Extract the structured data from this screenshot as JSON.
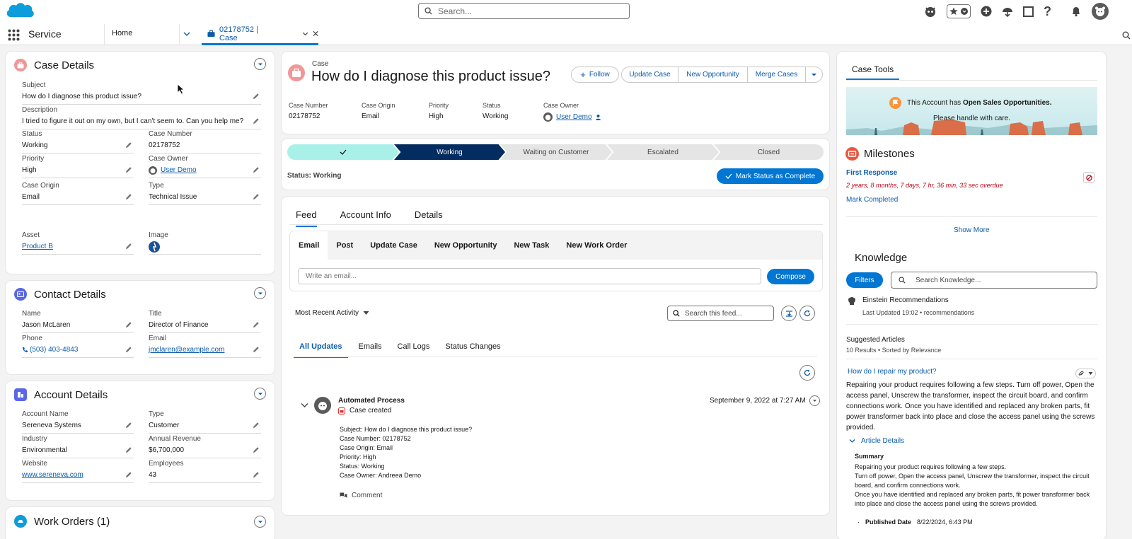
{
  "topbar": {
    "search_placeholder": "Search..."
  },
  "nav": {
    "app_name": "Service",
    "tabs": [
      {
        "label": "Home"
      },
      {
        "label": "02178752 | Case"
      }
    ]
  },
  "case_details": {
    "title": "Case Details",
    "fields": [
      {
        "label": "Subject",
        "value": "How do I diagnose this product issue?"
      },
      {
        "label": "Description",
        "value": "I tried to figure it out on my own, but I can't seem to. Can you help me?"
      },
      {
        "label": "Status",
        "value": "Working"
      },
      {
        "label": "Case Number",
        "value": "02178752"
      },
      {
        "label": "Priority",
        "value": "High"
      },
      {
        "label": "Case Owner",
        "value": "User Demo"
      },
      {
        "label": "Case Origin",
        "value": "Email"
      },
      {
        "label": "Type",
        "value": "Technical Issue"
      },
      {
        "label": "Asset",
        "value": "Product B"
      },
      {
        "label": "Image",
        "value": ""
      }
    ]
  },
  "contact_details": {
    "title": "Contact Details",
    "fields": [
      {
        "label": "Name",
        "value": "Jason McLaren"
      },
      {
        "label": "Title",
        "value": "Director of Finance"
      },
      {
        "label": "Phone",
        "value": "(503) 403-4843"
      },
      {
        "label": "Email",
        "value": "jmclaren@example.com"
      }
    ]
  },
  "account_details": {
    "title": "Account Details",
    "fields": [
      {
        "label": "Account Name",
        "value": "Sereneva Systems"
      },
      {
        "label": "Type",
        "value": "Customer"
      },
      {
        "label": "Industry",
        "value": "Environmental"
      },
      {
        "label": "Annual Revenue",
        "value": "$6,700,000"
      },
      {
        "label": "Website",
        "value": "www.sereneva.com"
      },
      {
        "label": "Employees",
        "value": "43"
      }
    ]
  },
  "work_orders": {
    "title": "Work Orders (1)"
  },
  "case_header": {
    "object_label": "Case",
    "title": "How do I diagnose this product issue?",
    "actions": {
      "follow": "Follow",
      "update": "Update Case",
      "new_opp": "New Opportunity",
      "merge": "Merge Cases"
    },
    "highlights": [
      {
        "label": "Case Number",
        "value": "02178752"
      },
      {
        "label": "Case Origin",
        "value": "Email"
      },
      {
        "label": "Priority",
        "value": "High"
      },
      {
        "label": "Status",
        "value": "Working"
      },
      {
        "label": "Case Owner",
        "value": "User Demo"
      }
    ]
  },
  "path": {
    "steps": [
      "",
      "Working",
      "Waiting on Customer",
      "Escalated",
      "Closed"
    ],
    "status_text": "Status: Working",
    "complete_button": "Mark Status as Complete"
  },
  "main_tabs": [
    "Feed",
    "Account Info",
    "Details"
  ],
  "publisher": {
    "tabs": [
      "Email",
      "Post",
      "Update Case",
      "New Opportunity",
      "New Task",
      "New Work Order"
    ],
    "placeholder": "Write an email...",
    "compose": "Compose"
  },
  "feed": {
    "sort": "Most Recent Activity",
    "search_placeholder": "Search this feed...",
    "filters": [
      "All Updates",
      "Emails",
      "Call Logs",
      "Status Changes"
    ],
    "item": {
      "author": "Automated Process",
      "action": "Case created",
      "timestamp": "September 9, 2022 at 7:27 AM",
      "lines": [
        {
          "k": "Subject:",
          "v": "How do I diagnose this product issue?"
        },
        {
          "k": "Case Number:",
          "v": "02178752"
        },
        {
          "k": "Case Origin:",
          "v": "Email"
        },
        {
          "k": "Priority:",
          "v": "High"
        },
        {
          "k": "Status:",
          "v": "Working"
        },
        {
          "k": "Case Owner:",
          "v": "Andreea Demo"
        }
      ],
      "comment": "Comment"
    }
  },
  "case_tools": {
    "tab": "Case Tools",
    "banner_prefix": "This Account has ",
    "banner_bold": "Open Sales Opportunities.",
    "banner_line2": "Please handle with care."
  },
  "milestones": {
    "title": "Milestones",
    "name": "First Response",
    "overdue": "2 years, 8 months, 7 days, 7 hr, 36 min, 33 sec overdue",
    "mark": "Mark Completed",
    "show_more": "Show More"
  },
  "knowledge": {
    "title": "Knowledge",
    "filters": "Filters",
    "search_placeholder": "Search Knowledge...",
    "einstein": "Einstein Recommendations",
    "updated": "Last Updated 19:02 • recommendations",
    "suggested": "Suggested Articles",
    "results": "10 Results • Sorted by Relevance",
    "article": {
      "title": "How do I repair my product?",
      "snippet": "Repairing your product requires following a few steps. Turn off power, Open the access panel, Unscrew the transformer, inspect the circuit board, and confirm connections work. Once you have identified and replaced any broken parts, fit power transformer back into place and close the access panel using the screws provided.",
      "details_label": "Article Details",
      "summary_label": "Summary",
      "summary": "Repairing your product requires following a few steps.",
      "summary2": "Turn off power, Open the access panel, Unscrew the transformer, inspect the circuit board, and confirm connections work.",
      "summary3": "Once you have identified and replaced any broken parts, fit power transformer back into place and close the access panel using the screws provided.",
      "published_label": "Published Date",
      "published": "8/22/2024, 6:43 PM"
    }
  },
  "colors": {
    "brand": "#0176d3",
    "navy": "#032d60",
    "path_done": "#a9f1e8",
    "overdue": "#ba0517"
  }
}
